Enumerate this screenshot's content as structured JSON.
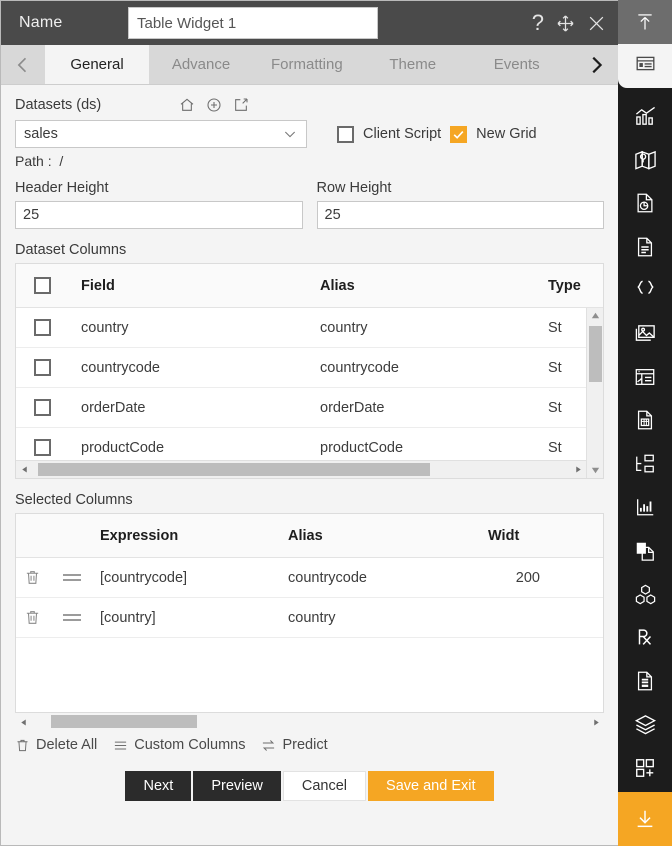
{
  "titlebar": {
    "name_label": "Name",
    "name_value": "Table Widget 1",
    "help_icon": "question-mark-icon",
    "move_icon": "move-icon",
    "close_icon": "close-icon"
  },
  "tabs": {
    "prev_icon": "chevron-left-icon",
    "next_icon": "chevron-right-icon",
    "items": [
      {
        "label": "General",
        "active": true
      },
      {
        "label": "Advance",
        "active": false
      },
      {
        "label": "Formatting",
        "active": false
      },
      {
        "label": "Theme",
        "active": false
      },
      {
        "label": "Events",
        "active": false
      }
    ]
  },
  "general": {
    "datasets_label": "Datasets (ds)",
    "dataset_actions": [
      "home-icon",
      "add-circle-icon",
      "edit-icon"
    ],
    "dataset_value": "sales",
    "client_script_label": "Client Script",
    "client_script_checked": false,
    "new_grid_label": "New Grid",
    "new_grid_checked": true,
    "path_label": "Path :",
    "path_value": "/",
    "header_height_label": "Header Height",
    "header_height_value": "25",
    "row_height_label": "Row Height",
    "row_height_value": "25"
  },
  "dataset_columns": {
    "title": "Dataset Columns",
    "headers": {
      "field": "Field",
      "alias": "Alias",
      "type": "Type"
    },
    "select_all_checked": false,
    "rows": [
      {
        "field": "country",
        "alias": "country",
        "type": "St"
      },
      {
        "field": "countrycode",
        "alias": "countrycode",
        "type": "St"
      },
      {
        "field": "orderDate",
        "alias": "orderDate",
        "type": "St"
      },
      {
        "field": "productCode",
        "alias": "productCode",
        "type": "St"
      }
    ]
  },
  "selected_columns": {
    "title": "Selected Columns",
    "headers": {
      "expression": "Expression",
      "alias": "Alias",
      "width": "Widt"
    },
    "rows": [
      {
        "expression": "[countrycode]",
        "alias": "countrycode",
        "width": "200"
      },
      {
        "expression": "[country]",
        "alias": "country",
        "width": ""
      }
    ]
  },
  "subbar": {
    "delete_all": "Delete All",
    "custom_columns": "Custom Columns",
    "predict": "Predict",
    "delete_all_icon": "trash-icon",
    "custom_columns_icon": "list-icon",
    "predict_icon": "swap-icon"
  },
  "footer": {
    "next": "Next",
    "preview": "Preview",
    "cancel": "Cancel",
    "save_and_exit": "Save and Exit"
  },
  "sidebar": {
    "top_icon": "collapse-up-icon",
    "active_icon": "table-widget-icon",
    "items": [
      "chart-icon",
      "map-icon",
      "pie-document-icon",
      "document-icon",
      "code-braces-icon",
      "image-icon",
      "calendar-grid-icon",
      "document-calc-icon",
      "tree-icon",
      "bar-chart-icon",
      "copy-document-icon",
      "cubes-icon",
      "prescription-icon",
      "report-document-icon",
      "layers-icon",
      "add-widget-icon"
    ],
    "bottom_icon": "download-icon"
  },
  "colors": {
    "accent": "#f5a623",
    "titlebar": "#4a4a4a",
    "sidebar": "#1c1c1c",
    "dark_button": "#2b2b2b"
  }
}
